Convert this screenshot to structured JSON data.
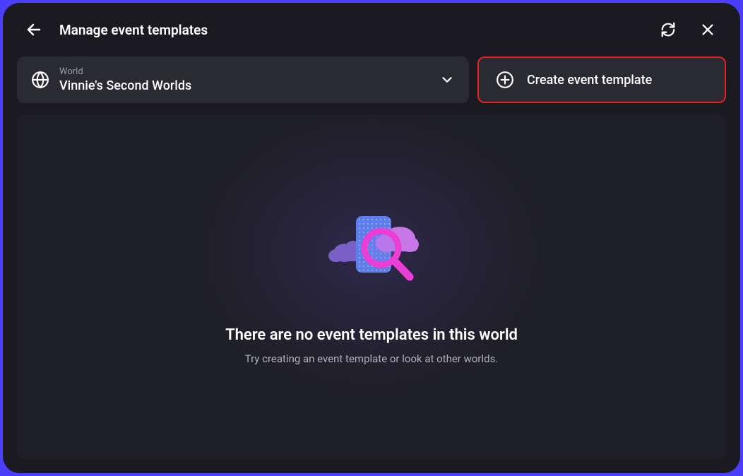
{
  "header": {
    "title": "Manage event templates"
  },
  "toolbar": {
    "world_label": "World",
    "world_name": "Vinnie's Second Worlds",
    "create_label": "Create event template"
  },
  "empty_state": {
    "title": "There are no event templates in this world",
    "subtitle": "Try creating an event template or look at other worlds."
  }
}
